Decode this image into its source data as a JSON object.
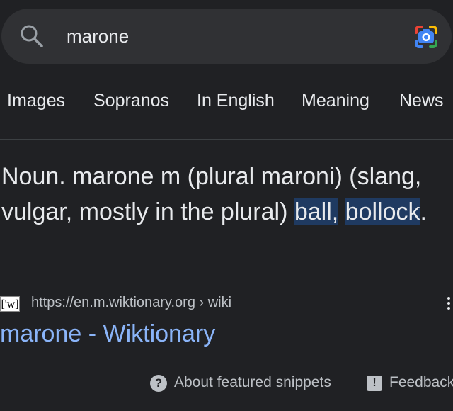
{
  "search": {
    "query": "marone",
    "search_icon": "search-icon",
    "lens_icon": "google-lens-icon"
  },
  "chips": [
    "Images",
    "Sopranos",
    "In English",
    "Meaning",
    "News"
  ],
  "snippet": {
    "text_before": "Noun. marone m (plural maroni) (slang, vulgar, mostly in the plural) ",
    "highlight_1": "ball,",
    "space": " ",
    "highlight_2": "bollock",
    "text_after": "."
  },
  "source": {
    "favicon_text": "['w]",
    "url": "https://en.m.wiktionary.org › wiki",
    "more_icon": "more-vert-icon"
  },
  "result": {
    "title": "marone - Wiktionary"
  },
  "footer": {
    "help_icon_glyph": "?",
    "about_label": "About featured snippets",
    "feedback_icon_glyph": "!",
    "feedback_label": "Feedback"
  },
  "colors": {
    "background": "#202124",
    "search_bar": "#303134",
    "highlight": "#1f3a61",
    "link": "#8ab4f8"
  }
}
